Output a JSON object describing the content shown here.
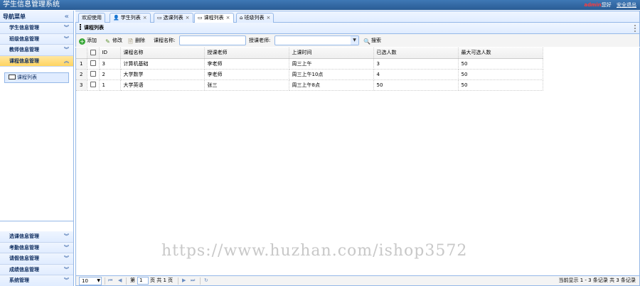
{
  "header": {
    "title": "学生信息管理系统",
    "user": "admin",
    "greeting": "您好",
    "logout": "安全退出"
  },
  "sidebar": {
    "title": "导航菜单",
    "collapse_icon": "«",
    "sections_top": [
      {
        "label": "学生信息管理"
      },
      {
        "label": "班级信息管理"
      },
      {
        "label": "教师信息管理"
      },
      {
        "label": "课程信息管理"
      }
    ],
    "active_links": [
      {
        "label": "课程列表"
      }
    ],
    "sections_bottom": [
      {
        "label": "选课信息管理"
      },
      {
        "label": "考勤信息管理"
      },
      {
        "label": "请假信息管理"
      },
      {
        "label": "成绩信息管理"
      },
      {
        "label": "系统管理"
      }
    ]
  },
  "tabs": [
    {
      "label": "欢迎使用",
      "closable": false,
      "icon": ""
    },
    {
      "label": "学生列表",
      "closable": true,
      "icon": "user-icon"
    },
    {
      "label": "选课列表",
      "closable": true,
      "icon": "book-icon"
    },
    {
      "label": "课程列表",
      "closable": true,
      "icon": "book-icon",
      "selected": true
    },
    {
      "label": "班级列表",
      "closable": true,
      "icon": "home-icon"
    }
  ],
  "tab_close": "×",
  "panel": {
    "title": "课程列表"
  },
  "toolbar": {
    "add": "添加",
    "edit": "修改",
    "delete": "删除",
    "course_name_label": "课程名称:",
    "course_name_value": "",
    "teacher_label": "授课老师:",
    "teacher_value": "",
    "search": "搜索"
  },
  "grid": {
    "columns": [
      "ID",
      "课程名称",
      "授课老师",
      "上课时间",
      "已选人数",
      "最大可选人数"
    ],
    "rows": [
      {
        "num": "1",
        "id": "3",
        "name": "计算机基础",
        "teacher": "李老师",
        "time": "周三上午",
        "selected": "3",
        "max": "50"
      },
      {
        "num": "2",
        "id": "2",
        "name": "大学数学",
        "teacher": "李老师",
        "time": "周三上午10点",
        "selected": "4",
        "max": "50"
      },
      {
        "num": "3",
        "id": "1",
        "name": "大学英语",
        "teacher": "张三",
        "time": "周三上午8点",
        "selected": "50",
        "max": "50"
      }
    ]
  },
  "watermark": "https://www.huzhan.com/ishop3572",
  "pager": {
    "page_size": "10",
    "page_label_before": "第",
    "page_value": "1",
    "page_label_after": "页 共 1 页",
    "info": "当前显示 1 - 3 条记录 共 3 条记录"
  },
  "colors": {
    "header": "#2f6aa8",
    "border": "#95b8e7",
    "active_section": "#ffd460",
    "user": "#ff3b3b"
  }
}
